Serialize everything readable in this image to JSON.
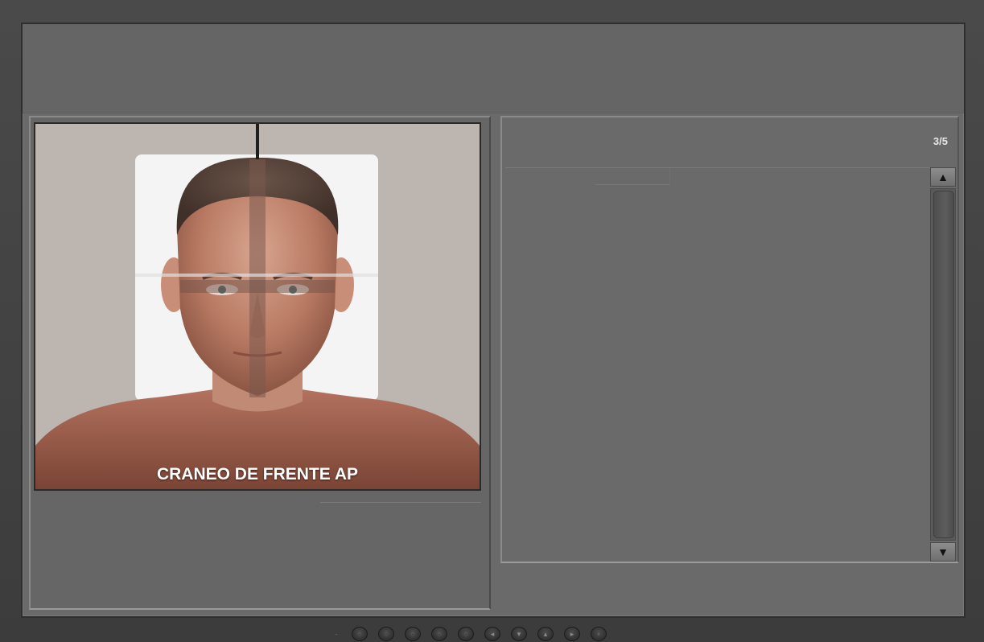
{
  "viewer": {
    "page_counter": "3/5",
    "image_caption": "CRANEO DE FRENTE AP"
  },
  "scrollbar": {
    "up_icon": "▲",
    "down_icon": "▼"
  },
  "controls": [
    {
      "icon": "speaker-icon",
      "glyph": "·"
    },
    {
      "icon": "circle-button-1-icon",
      "glyph": "◌"
    },
    {
      "icon": "circle-button-2-icon",
      "glyph": "◌"
    },
    {
      "icon": "circle-button-3-icon",
      "glyph": "◌"
    },
    {
      "icon": "menu-icon",
      "glyph": "◌"
    },
    {
      "icon": "stop-icon",
      "glyph": "◌"
    },
    {
      "icon": "back-icon",
      "glyph": "◂"
    },
    {
      "icon": "down-icon",
      "glyph": "▾"
    },
    {
      "icon": "up-icon",
      "glyph": "▴"
    },
    {
      "icon": "forward-icon",
      "glyph": "▸"
    },
    {
      "icon": "exit-icon",
      "glyph": "◦"
    }
  ],
  "colors": {
    "screen_bg": "#6a6a6a",
    "caption_text": "#ffffff"
  }
}
